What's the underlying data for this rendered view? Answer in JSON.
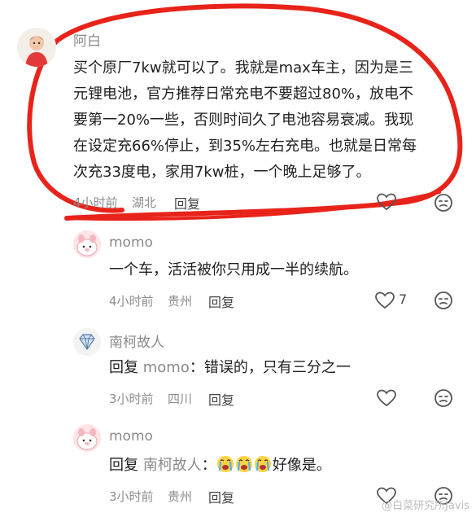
{
  "comments": [
    {
      "user": "阿白",
      "lines": [
        "买个原厂7kw就可以了。我就是max车主，因为是三",
        "元锂电池，官方推荐日常充电不要超过80%，放电不",
        "要第一20%一些，否则时间久了电池容易衰减。我现",
        "在设定充66%停止，到35%左右充电。也就是日常每",
        "次充33度电，家用7kw桩，一个晚上足够了。"
      ],
      "time": "4小时前",
      "location": "湖北",
      "reply": "回复"
    },
    {
      "user": "momo",
      "text": "一个车，活活被你只用成一半的续航。",
      "time": "4小时前",
      "location": "贵州",
      "reply": "回复",
      "likes": "7"
    },
    {
      "user": "南柯故人",
      "reply_prefix": "回复",
      "mention": "momo",
      "text": "：错误的，只有三分之一",
      "time": "3小时前",
      "location": "四川",
      "reply": "回复"
    },
    {
      "user": "momo",
      "reply_prefix": "回复",
      "mention": "南柯故人",
      "text_suffix": "好像是。",
      "emoji_name": "crying-face-emoji",
      "time": "3小时前",
      "location": "贵州",
      "reply": "回复"
    }
  ],
  "watermark": "@白菜研究所Javis",
  "annotation_color": "#e8231a"
}
